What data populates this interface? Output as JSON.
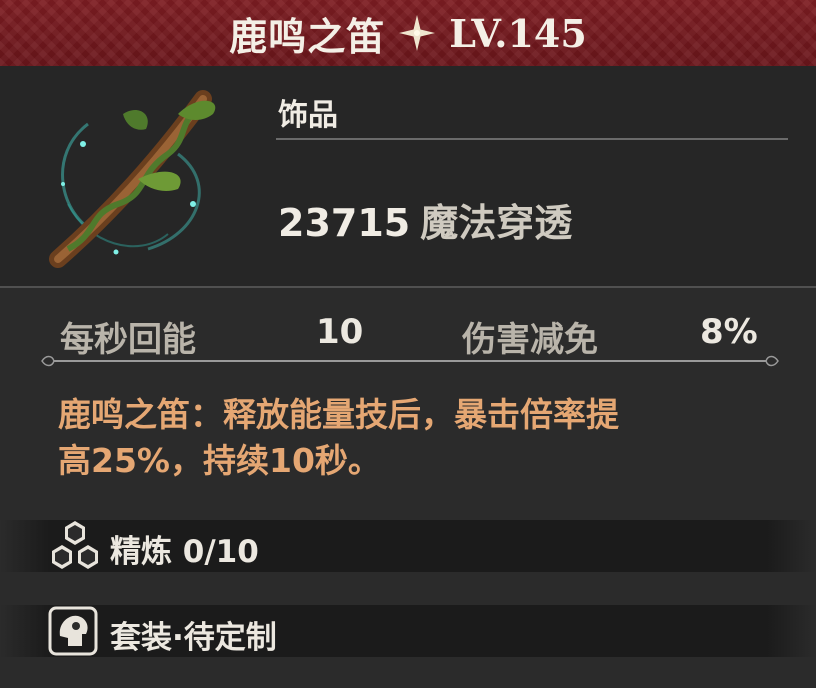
{
  "header": {
    "name": "鹿鸣之笛",
    "level": "LV.145",
    "star_icon": "four-point-star-icon",
    "bg_color": "#75191e"
  },
  "item": {
    "image": "flute-branch-icon",
    "type": "饰品",
    "main_stat_value": "23715",
    "main_stat_label": "魔法穿透"
  },
  "substats": [
    {
      "label": "每秒回能",
      "value": "10"
    },
    {
      "label": "伤害减免",
      "value": "8%"
    }
  ],
  "description": {
    "line1": "鹿鸣之笛：释放能量技后，暴击倍率提",
    "line2": "高25%，持续10秒。",
    "color": "#e5a773"
  },
  "refine": {
    "label": "精炼 0/10",
    "icon": "hexagon-cluster-icon"
  },
  "set": {
    "label": "套装·待定制",
    "icon": "armor-helmet-icon"
  }
}
